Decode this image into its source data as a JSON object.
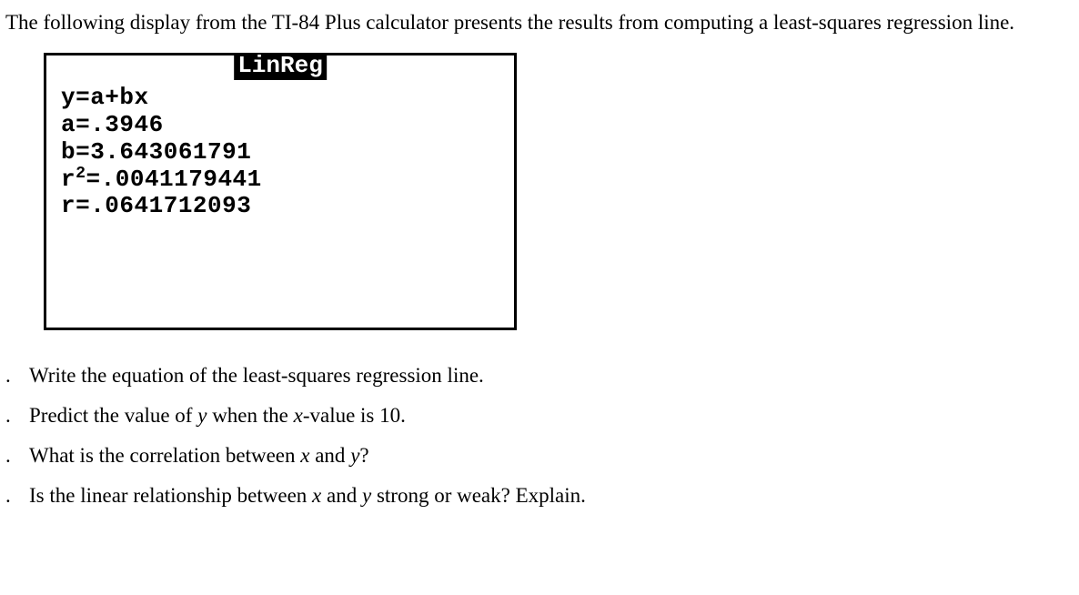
{
  "intro": "The following display from the TI-84 Plus calculator presents the results from computing a least-squares regression line.",
  "calc": {
    "header": "LinReg",
    "line1": "y=a+bx",
    "line2": "a=.3946",
    "line3": "b=3.643061791",
    "line4_pre": "r",
    "line4_sup": "2",
    "line4_post": "=.0041179441",
    "line5": "r=.0641712093"
  },
  "questions": {
    "q1": "Write the equation of the least-squares regression line.",
    "q2_pre": "Predict the value of ",
    "q2_y": "y",
    "q2_mid": " when the ",
    "q2_x": "x",
    "q2_post": "-value is 10.",
    "q3_pre": "What is the correlation between ",
    "q3_x": "x",
    "q3_and": " and ",
    "q3_y": "y",
    "q3_post": "?",
    "q4_pre": "Is the linear relationship between ",
    "q4_x": "x",
    "q4_and": " and ",
    "q4_y": "y",
    "q4_post": " strong or weak? Explain."
  }
}
